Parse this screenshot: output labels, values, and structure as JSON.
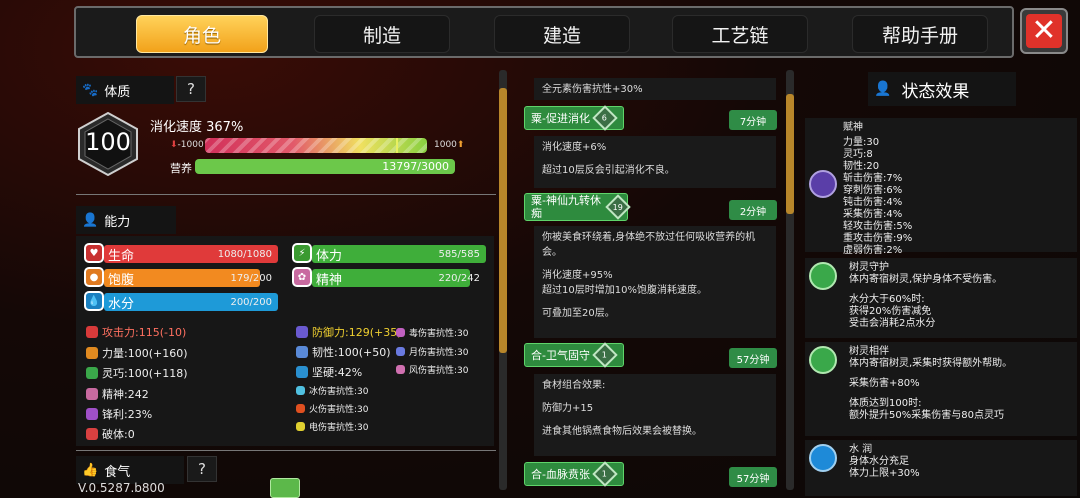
{
  "tabs": [
    "角色",
    "制造",
    "建造",
    "工艺链",
    "帮助手册"
  ],
  "close_icon": "close-x-icon",
  "constitution": {
    "title": "体质",
    "help": "?",
    "level": "100",
    "digest_label": "消化速度 367%",
    "min": "-1000",
    "max": "1000",
    "nutrition_label": "营养",
    "nutrition_value": "13797/3000",
    "digest_fraction": 0.86,
    "nutrition_fraction": 1.0
  },
  "ability": {
    "title": "能力"
  },
  "stats": [
    {
      "label": "生命",
      "value": "1080/1080",
      "color": "#e03a3a",
      "fraction": 1.0
    },
    {
      "label": "体力",
      "value": "585/585",
      "color": "#3fae3a",
      "fraction": 1.0
    },
    {
      "label": "饱腹",
      "value": "179/200",
      "color": "#f28a20",
      "fraction": 0.895
    },
    {
      "label": "精神",
      "value": "220/242",
      "color": "#3fae3a",
      "fraction": 0.909
    },
    {
      "label": "水分",
      "value": "200/200",
      "color": "#1e9ad8",
      "fraction": 1.0
    }
  ],
  "attrs_left": [
    "攻击力:115(-10)",
    "力量:100(+160)",
    "灵巧:100(+118)",
    "精神:242",
    "锋利:23%",
    "破体:0"
  ],
  "attrs_mid": [
    "防御力:129(+35)",
    "韧性:100(+50)",
    "坚硬:42%",
    "冰伤害抗性:30",
    "火伤害抗性:30",
    "电伤害抗性:30"
  ],
  "attrs_right": [
    "毒伤害抗性:30",
    "月伤害抗性:30",
    "风伤害抗性:30"
  ],
  "appetite": {
    "title": "食气",
    "help": "?"
  },
  "version": "V.0.5287.b800",
  "mid_top": "全元素伤害抗性+30%",
  "foods": [
    {
      "title": "粟-促进消化",
      "level": "6",
      "time": "7分钟",
      "lines": [
        "消化速度+6%",
        "",
        "超过10层反会引起消化不良。"
      ]
    },
    {
      "title": "粟-神仙九转休痴",
      "level": "19",
      "time": "2分钟",
      "lines": [
        "你被美食环绕着,身体绝不放过任何吸收营养的机",
        "会。",
        "",
        "消化速度+95%",
        "超过10层时增加10%饱腹消耗速度。",
        "",
        "可叠加至20层。"
      ]
    },
    {
      "title": "合-卫气固守",
      "level": "1",
      "time": "57分钟",
      "lines": [
        "食材组合效果:",
        "",
        "防御力+15",
        "",
        "进食其他锅煮食物后效果会被替换。"
      ]
    },
    {
      "title": "合-血脉贲张",
      "level": "1",
      "time": "57分钟",
      "lines": []
    }
  ],
  "status": {
    "title": "状态效果",
    "effects": [
      {
        "name": "赋神",
        "lines": [
          "力量:30",
          "灵巧:8",
          "韧性:20",
          "斩击伤害:7%",
          "穿刺伤害:6%",
          "钝击伤害:4%",
          "采集伤害:4%",
          "轻攻击伤害:5%",
          "重攻击伤害:9%",
          "虚弱伤害:2%"
        ],
        "color": "#5a3ea8"
      },
      {
        "name": "树灵守护",
        "lines": [
          "体内寄宿树灵,保护身体不受伤害。",
          "",
          "水分大于60%时:",
          "获得20%伤害减免",
          "受击会消耗2点水分"
        ],
        "color": "#3aa84a"
      },
      {
        "name": "树灵相伴",
        "lines": [
          "体内寄宿树灵,采集时获得额外帮助。",
          "",
          "采集伤害+80%",
          "",
          "体质达到100时:",
          "额外提升50%采集伤害与80点灵巧"
        ],
        "color": "#3aa84a"
      },
      {
        "name": "水 润",
        "lines": [
          "身体水分充足",
          "体力上限+30%"
        ],
        "color": "#1e8ad8"
      }
    ]
  }
}
